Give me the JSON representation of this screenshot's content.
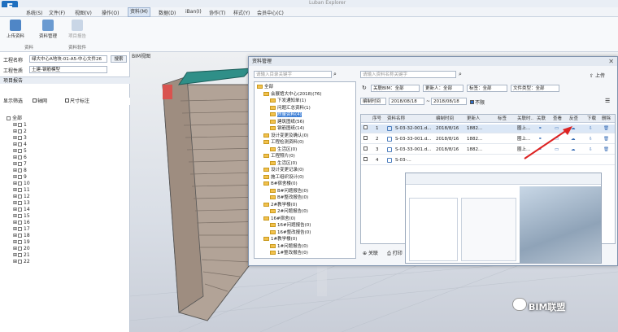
{
  "window": {
    "title": "Luban Explorer"
  },
  "menu": [
    "系统(S)",
    "文件(F)",
    "视图(V)",
    "操作(O)",
    "资料(M)",
    "数据(D)",
    "iBan(I)",
    "协作(T)",
    "样式(Y)",
    "会员中心(C)"
  ],
  "ribbon": {
    "buttons": [
      "上传资料",
      "资料管理",
      "项目报告"
    ],
    "group_labels": [
      "资料",
      "资料软件"
    ]
  },
  "left": {
    "project_label": "工程名称",
    "project_value": "绿大中心A地块-01-A5-中心文件26",
    "search_button": "搜索",
    "work_label": "工程性质",
    "work_value": "土建-钢筋模型",
    "section_title": "项目报告",
    "display_label": "显示筛选",
    "opt1": "轴网",
    "opt2": "尺寸标注",
    "tree_root": "全部",
    "floors": [
      "1",
      "2",
      "3",
      "4",
      "5",
      "6",
      "7",
      "8",
      "9",
      "10",
      "11",
      "12",
      "13",
      "14",
      "15",
      "16",
      "17",
      "18",
      "19",
      "20",
      "21",
      "22"
    ]
  },
  "viewport": {
    "title": "BIM视图"
  },
  "dialog": {
    "title": "资料管理",
    "search_placeholder": "请输入目录关键字",
    "search2_placeholder": "请输入资料名称关键字",
    "upload_button": "上传",
    "filter_bim": "关联BIM：全部",
    "filter_uploader": "更新人：全部",
    "filter_tag": "标签：全部",
    "filter_type": "文件类型：全部",
    "filter_time_label": "编制时间",
    "date_from": "2018/08/18",
    "date_to": "2018/08/18",
    "checkbox_none": "不限",
    "tree": [
      {
        "label": "全部",
        "level": 0
      },
      {
        "label": "会展馆大中心(2018)(76)",
        "level": 1
      },
      {
        "label": "下发通知单(1)",
        "level": 2
      },
      {
        "label": "问题汇总资料(1)",
        "level": 2
      },
      {
        "label": "质量资料(4)",
        "level": 2,
        "selected": true
      },
      {
        "label": "建筑图纸(56)",
        "level": 2
      },
      {
        "label": "钢筋图纸(14)",
        "level": 2
      },
      {
        "label": "设计变更及确认(0)",
        "level": 1
      },
      {
        "label": "工程检测资料(0)",
        "level": 1
      },
      {
        "label": "生活区(0)",
        "level": 2
      },
      {
        "label": "工程照片(0)",
        "level": 1
      },
      {
        "label": "生活区(0)",
        "level": 2
      },
      {
        "label": "设计变更记录(0)",
        "level": 1
      },
      {
        "label": "施工组织设计(0)",
        "level": 1
      },
      {
        "label": "B#宿舍楼(0)",
        "level": 1
      },
      {
        "label": "B#问题报告(0)",
        "level": 2
      },
      {
        "label": "B#整改报告(0)",
        "level": 2
      },
      {
        "label": "2#教学楼(0)",
        "level": 1
      },
      {
        "label": "2#问题报告(0)",
        "level": 2
      },
      {
        "label": "16#宿舍(0)",
        "level": 1
      },
      {
        "label": "16#问题报告(0)",
        "level": 2
      },
      {
        "label": "16#整改报告(0)",
        "level": 2
      },
      {
        "label": "1#教学楼(0)",
        "level": 1
      },
      {
        "label": "1#问题报告(0)",
        "level": 2
      },
      {
        "label": "1#整改报告(0)",
        "level": 2
      }
    ],
    "columns": [
      "序号",
      "资料名称",
      "编制时间",
      "更新人",
      "标签",
      "关联时..",
      "关联",
      "查看",
      "反查",
      "下载",
      "删除"
    ],
    "rows": [
      {
        "no": "1",
        "name": "S-03-32-001.d...",
        "date": "2018/8/16",
        "user": "1882...",
        "related": "圈上..."
      },
      {
        "no": "2",
        "name": "S-03-33-001.d...",
        "date": "2018/8/16",
        "user": "1882...",
        "related": "圈上..."
      },
      {
        "no": "3",
        "name": "S-03-33-001.d...",
        "date": "2018/8/16",
        "user": "1882...",
        "related": "圈上..."
      },
      {
        "no": "4",
        "name": "S-03-...",
        "date": "",
        "user": "",
        "related": ""
      }
    ],
    "footer_link": "关联",
    "footer_print": "打印"
  },
  "watermark": "BIM联盟"
}
